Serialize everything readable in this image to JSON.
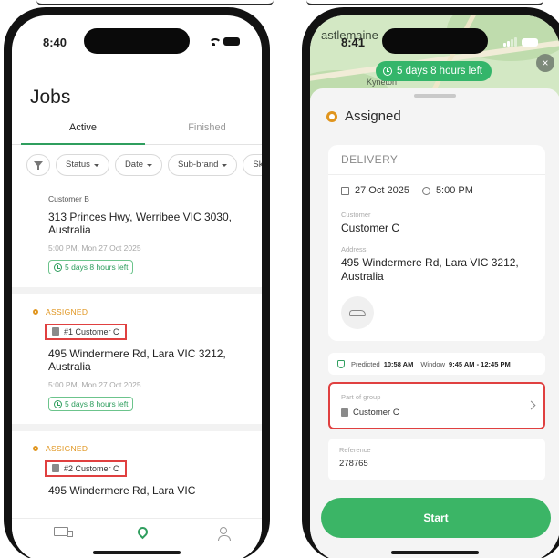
{
  "colors": {
    "accent_green": "#34b56a",
    "assigned_orange": "#e0951e",
    "highlight_red": "#e04040"
  },
  "left_phone": {
    "status_time": "8:40",
    "title": "Jobs",
    "tabs": [
      {
        "label": "Active"
      },
      {
        "label": "Finished"
      }
    ],
    "filters": [
      {
        "icon": "filter-icon"
      },
      {
        "label": "Status"
      },
      {
        "label": "Date"
      },
      {
        "label": "Sub-brand"
      },
      {
        "label": "Skill"
      }
    ],
    "jobs": [
      {
        "customer": "Customer B",
        "address": "313 Princes Hwy, Werribee VIC 3030, Australia",
        "datetime": "5:00 PM, Mon 27 Oct 2025",
        "time_left": "5 days 8 hours left"
      },
      {
        "status": "ASSIGNED",
        "group_tag": "#1  Customer C",
        "address": "495 Windermere Rd, Lara VIC 3212, Australia",
        "datetime": "5:00 PM, Mon 27 Oct 2025",
        "time_left": "5 days 8 hours left"
      },
      {
        "status": "ASSIGNED",
        "group_tag": "#2  Customer C",
        "address": "495 Windermere Rd, Lara VIC"
      }
    ],
    "tabbar": [
      {
        "icon": "truck-icon"
      },
      {
        "icon": "map-pin-icon"
      },
      {
        "icon": "person-icon"
      }
    ]
  },
  "right_phone": {
    "status_time": "8:41",
    "map_town": "astlemaine",
    "map_town2": "Kyneton",
    "time_left_pill": "5 days 8 hours left",
    "close": "×",
    "status": "Assigned",
    "card": {
      "type": "DELIVERY",
      "date": "27 Oct 2025",
      "time": "5:00 PM",
      "customer_label": "Customer",
      "customer": "Customer C",
      "address_label": "Address",
      "address": "495 Windermere Rd, Lara VIC 3212, Australia"
    },
    "predicted": {
      "label": "Predicted",
      "time": "10:58 AM",
      "window_label": "Window",
      "window": "9:45 AM - 12:45 PM"
    },
    "group": {
      "label": "Part of group",
      "value": "Customer C"
    },
    "reference": {
      "label": "Reference",
      "value": "278765"
    },
    "start_label": "Start"
  }
}
